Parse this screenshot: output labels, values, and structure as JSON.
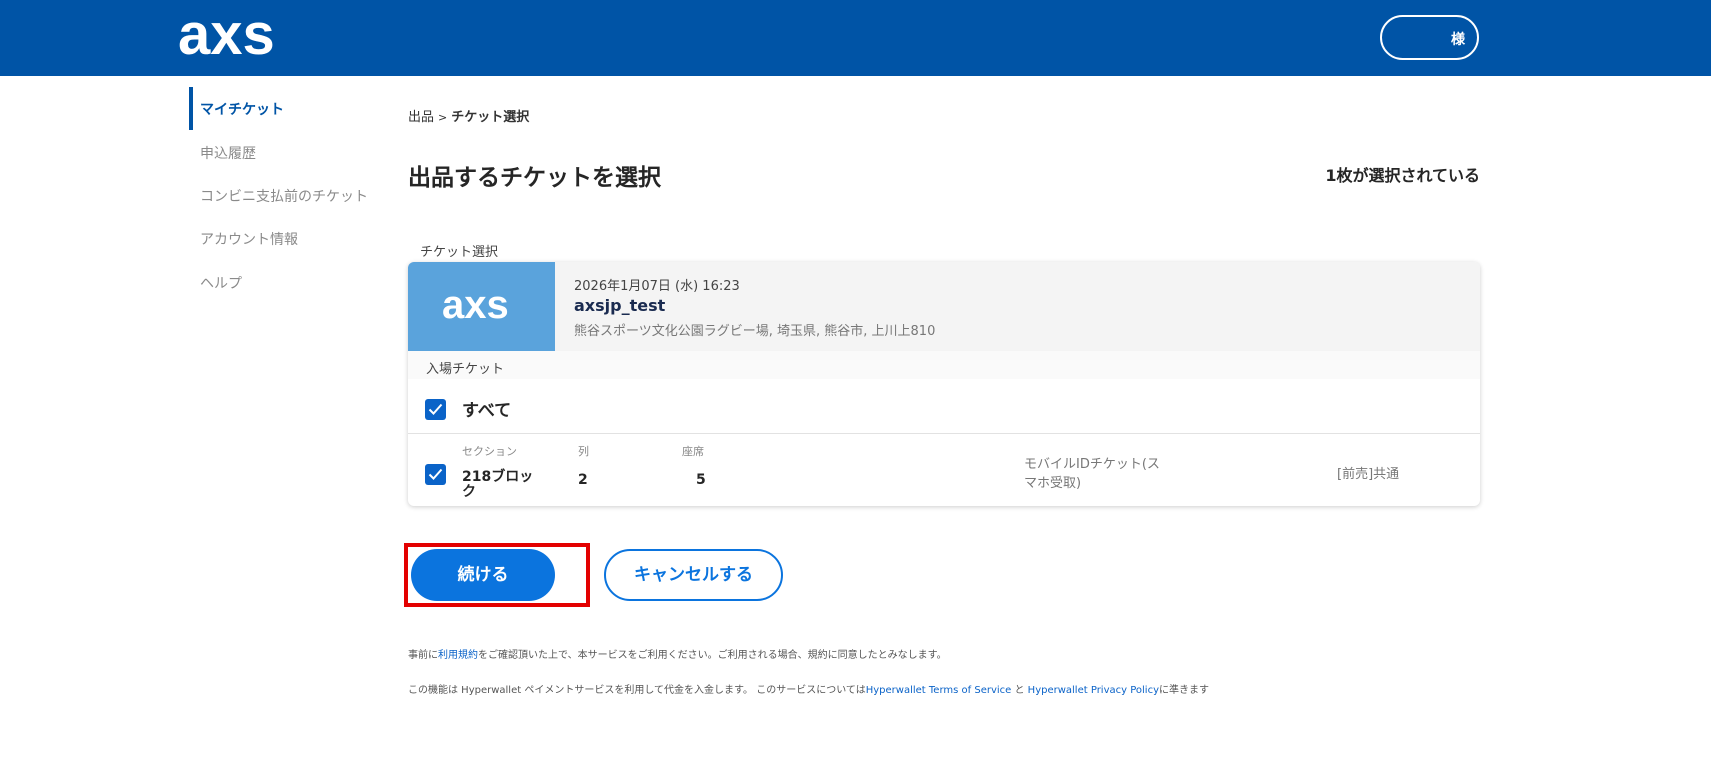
{
  "header": {
    "logo_text": "axs",
    "user_label": "様"
  },
  "sidebar": {
    "items": [
      {
        "label": "マイチケット",
        "active": true
      },
      {
        "label": "申込履歴",
        "active": false
      },
      {
        "label": "コンビニ支払前のチケット",
        "active": false
      },
      {
        "label": "アカウント情報",
        "active": false
      },
      {
        "label": "ヘルプ",
        "active": false
      }
    ]
  },
  "breadcrumb": {
    "parent": "出品",
    "separator": ">",
    "current": "チケット選択"
  },
  "page": {
    "title": "出品するチケットを選択",
    "selected_count": "1枚が選択されている",
    "section_label": "チケット選択"
  },
  "event": {
    "date": "2026年1月07日 (水) 16:23",
    "name": "axsjp_test",
    "venue": "熊谷スポーツ文化公園ラグビー場, 埼玉県, 熊谷市, 上川上810",
    "thumb_logo": "axs"
  },
  "tickets": {
    "type_label": "入場チケット",
    "select_all_label": "すべて",
    "select_all_checked": true,
    "columns": {
      "section": "セクション",
      "row": "列",
      "seat": "座席"
    },
    "rows": [
      {
        "checked": true,
        "section_line1": "218ブロッ",
        "section_line2": "ク",
        "row": "2",
        "seat": "5",
        "delivery_line1": "モバイルIDチケット(ス",
        "delivery_line2": "マホ受取)",
        "price_type": "[前売]共通"
      }
    ]
  },
  "actions": {
    "continue_label": "続ける",
    "cancel_label": "キャンセルする"
  },
  "footer": {
    "terms_prefix": "事前に",
    "terms_link": "利用規約",
    "terms_suffix": "をご確認頂いた上で、本サービスをご利用ください。ご利用される場合、規約に同意したとみなします。",
    "hw_prefix": "この機能は Hyperwallet ペイメントサービスを利用して代金を入金します。 このサービスについては",
    "hw_tos_link": "Hyperwallet Terms of Service",
    "hw_and": " と ",
    "hw_privacy_link": "Hyperwallet Privacy Policy",
    "hw_suffix": "に準きます"
  },
  "colors": {
    "header_bg": "#0054a6",
    "primary": "#0b74de",
    "highlight": "#e30000",
    "thumb_bg": "#5aa3dc"
  }
}
